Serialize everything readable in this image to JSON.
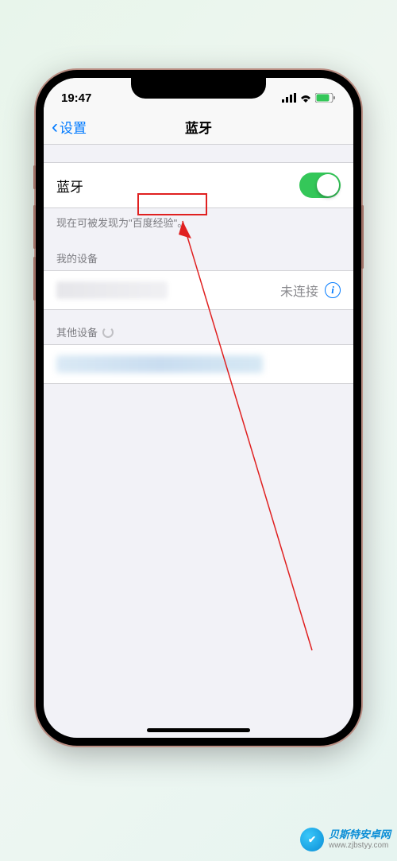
{
  "status": {
    "time": "19:47"
  },
  "nav": {
    "back_label": "设置",
    "title": "蓝牙"
  },
  "bluetooth": {
    "label": "蓝牙",
    "discoverable_prefix": "现在可被发现为",
    "discoverable_name": "\"百度经验\"",
    "discoverable_suffix": "。"
  },
  "sections": {
    "my_devices": "我的设备",
    "other_devices": "其他设备"
  },
  "device": {
    "status": "未连接"
  },
  "watermark": {
    "title": "贝斯特安卓网",
    "url": "www.zjbstyy.com"
  }
}
